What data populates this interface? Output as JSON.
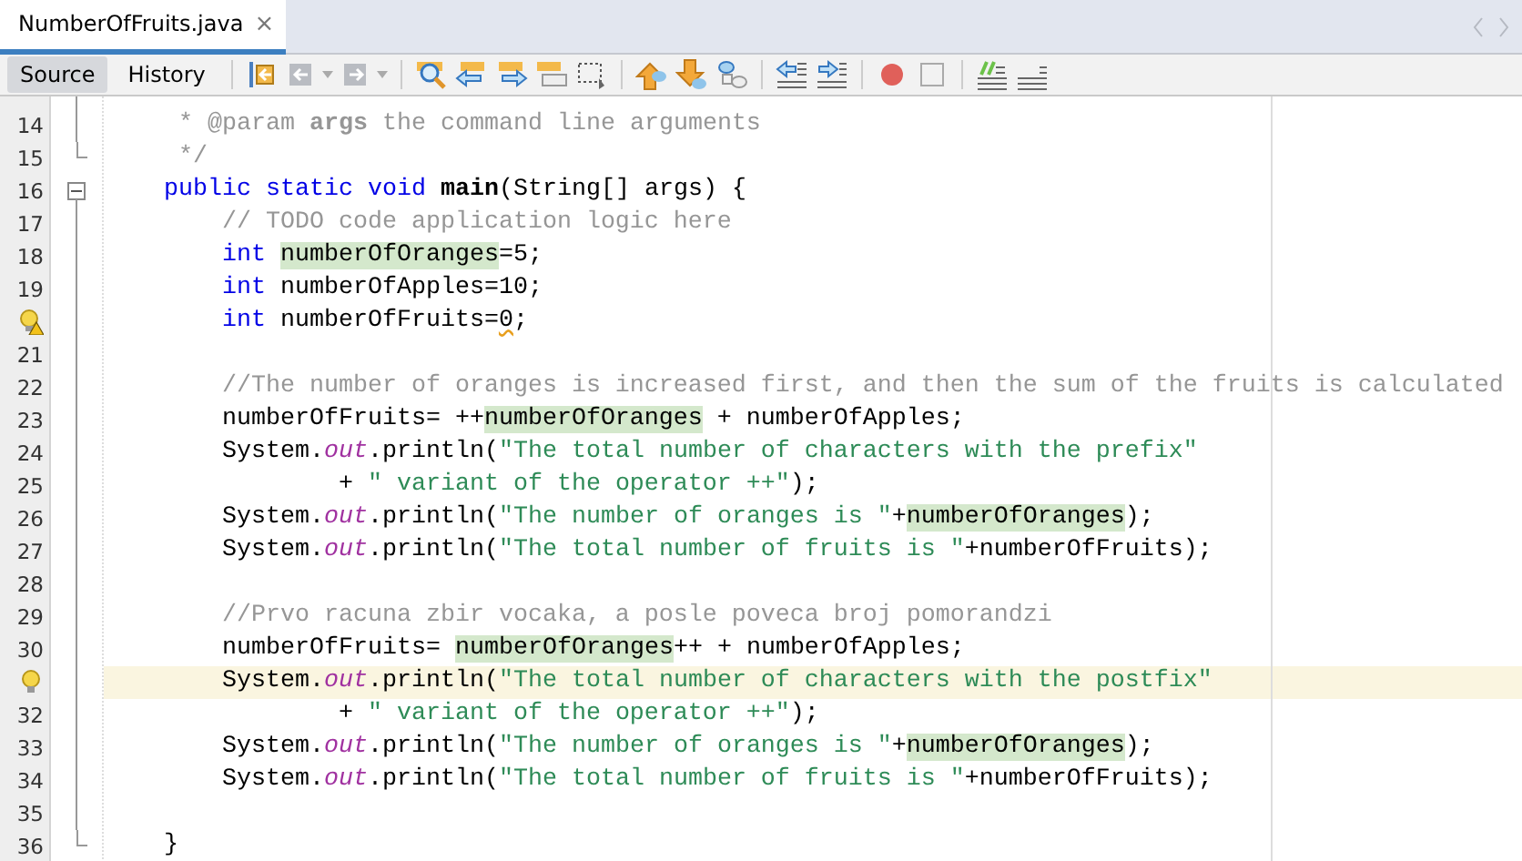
{
  "file_tab": {
    "title": "NumberOfFruits.java",
    "close": "×"
  },
  "view_tabs": [
    {
      "label": "Source",
      "selected": true
    },
    {
      "label": "History",
      "selected": false
    }
  ],
  "recording": {
    "on": false
  },
  "lines": [
    {
      "number": "14",
      "kind": "plain",
      "fold_start": false,
      "fold_end": false,
      "current": false,
      "tokens": [
        {
          "kind": "comment",
          "text": "     * @param "
        },
        {
          "kind": "commentbold",
          "text": "args"
        },
        {
          "kind": "comment",
          "text": " the command line arguments"
        }
      ]
    },
    {
      "number": "15",
      "kind": "plain",
      "fold_start": false,
      "fold_end": true,
      "current": false,
      "tokens": [
        {
          "kind": "comment",
          "text": "     */"
        }
      ]
    },
    {
      "number": "16",
      "kind": "plain",
      "fold_start": true,
      "fold_end": false,
      "current": false,
      "tokens": [
        {
          "kind": "kw",
          "text": "    public static void"
        },
        {
          "kind": "bold",
          "text": " main"
        },
        {
          "kind": "plain",
          "text": "(String[] args) {"
        }
      ]
    },
    {
      "number": "17",
      "kind": "plain",
      "fold_start": false,
      "fold_end": false,
      "current": false,
      "tokens": [
        {
          "kind": "comment",
          "text": "        // TODO code application logic here"
        }
      ]
    },
    {
      "number": "18",
      "kind": "plain",
      "fold_start": false,
      "fold_end": false,
      "current": false,
      "tokens": [
        {
          "kind": "kw",
          "text": "        int "
        },
        {
          "kind": "mark",
          "text": "numberOfOranges"
        },
        {
          "kind": "plain",
          "text": "=5;"
        }
      ]
    },
    {
      "number": "19",
      "kind": "plain",
      "fold_start": false,
      "fold_end": false,
      "current": false,
      "tokens": [
        {
          "kind": "kw",
          "text": "        int"
        },
        {
          "kind": "plain",
          "text": " numberOfApples=10;"
        }
      ]
    },
    {
      "kind": "warning",
      "fold_start": false,
      "fold_end": false,
      "current": false,
      "tokens": [
        {
          "kind": "kw",
          "text": "        int"
        },
        {
          "kind": "plain",
          "text": " numberOfFruits="
        },
        {
          "kind": "warn",
          "text": "0"
        },
        {
          "kind": "plain",
          "text": ";"
        }
      ]
    },
    {
      "number": "21",
      "kind": "plain",
      "fold_start": false,
      "fold_end": false,
      "current": false
    },
    {
      "number": "22",
      "kind": "plain",
      "fold_start": false,
      "fold_end": false,
      "current": false,
      "tokens": [
        {
          "kind": "comment",
          "text": "        //The number of oranges is increased first, and then the sum of the fruits is calculated"
        }
      ]
    },
    {
      "number": "23",
      "kind": "plain",
      "fold_start": false,
      "fold_end": false,
      "current": false,
      "tokens": [
        {
          "kind": "plain",
          "text": "        numberOfFruits= ++"
        },
        {
          "kind": "mark",
          "text": "numberOfOranges"
        },
        {
          "kind": "plain",
          "text": " + numberOfApples;"
        }
      ]
    },
    {
      "number": "24",
      "kind": "plain",
      "fold_start": false,
      "fold_end": false,
      "current": false,
      "tokens": [
        {
          "kind": "plain",
          "text": "        System."
        },
        {
          "kind": "field",
          "text": "out"
        },
        {
          "kind": "plain",
          "text": ".println("
        },
        {
          "kind": "string",
          "text": "\"The total number of characters with the prefix\""
        }
      ]
    },
    {
      "number": "25",
      "kind": "plain",
      "fold_start": false,
      "fold_end": false,
      "current": false,
      "tokens": [
        {
          "kind": "plain",
          "text": "                + "
        },
        {
          "kind": "string",
          "text": "\" variant of the operator ++\""
        },
        {
          "kind": "plain",
          "text": ");"
        }
      ]
    },
    {
      "number": "26",
      "kind": "plain",
      "fold_start": false,
      "fold_end": false,
      "current": false,
      "tokens": [
        {
          "kind": "plain",
          "text": "        System."
        },
        {
          "kind": "field",
          "text": "out"
        },
        {
          "kind": "plain",
          "text": ".println("
        },
        {
          "kind": "string",
          "text": "\"The number of oranges is \""
        },
        {
          "kind": "plain",
          "text": "+"
        },
        {
          "kind": "mark",
          "text": "numberOfOranges"
        },
        {
          "kind": "plain",
          "text": ");"
        }
      ]
    },
    {
      "number": "27",
      "kind": "plain",
      "fold_start": false,
      "fold_end": false,
      "current": false,
      "tokens": [
        {
          "kind": "plain",
          "text": "        System."
        },
        {
          "kind": "field",
          "text": "out"
        },
        {
          "kind": "plain",
          "text": ".println("
        },
        {
          "kind": "string",
          "text": "\"The total number of fruits is \""
        },
        {
          "kind": "plain",
          "text": "+numberOfFruits);"
        }
      ]
    },
    {
      "number": "28",
      "kind": "plain",
      "fold_start": false,
      "fold_end": false,
      "current": false
    },
    {
      "number": "29",
      "kind": "plain",
      "fold_start": false,
      "fold_end": false,
      "current": false,
      "tokens": [
        {
          "kind": "comment",
          "text": "        //Prvo racuna zbir vocaka, a posle poveca broj pomorandzi"
        }
      ]
    },
    {
      "number": "30",
      "kind": "plain",
      "fold_start": false,
      "fold_end": false,
      "current": false,
      "tokens": [
        {
          "kind": "plain",
          "text": "        numberOfFruits= "
        },
        {
          "kind": "mark",
          "text": "numberOfOranges"
        },
        {
          "kind": "plain",
          "text": "++ + numberOfApples;"
        }
      ]
    },
    {
      "kind": "hint",
      "fold_start": false,
      "fold_end": false,
      "current": true,
      "tokens": [
        {
          "kind": "plain",
          "text": "        System."
        },
        {
          "kind": "field",
          "text": "out"
        },
        {
          "kind": "plain",
          "text": ".println("
        },
        {
          "kind": "string",
          "text": "\"The total number of characters with the postfix\""
        }
      ]
    },
    {
      "number": "32",
      "kind": "plain",
      "fold_start": false,
      "fold_end": false,
      "current": false,
      "tokens": [
        {
          "kind": "plain",
          "text": "                + "
        },
        {
          "kind": "string",
          "text": "\" variant of the operator ++\""
        },
        {
          "kind": "plain",
          "text": ");"
        }
      ]
    },
    {
      "number": "33",
      "kind": "plain",
      "fold_start": false,
      "fold_end": false,
      "current": false,
      "tokens": [
        {
          "kind": "plain",
          "text": "        System."
        },
        {
          "kind": "field",
          "text": "out"
        },
        {
          "kind": "plain",
          "text": ".println("
        },
        {
          "kind": "string",
          "text": "\"The number of oranges is \""
        },
        {
          "kind": "plain",
          "text": "+"
        },
        {
          "kind": "mark",
          "text": "numberOfOranges"
        },
        {
          "kind": "plain",
          "text": ");"
        }
      ]
    },
    {
      "number": "34",
      "kind": "plain",
      "fold_start": false,
      "fold_end": false,
      "current": false,
      "tokens": [
        {
          "kind": "plain",
          "text": "        System."
        },
        {
          "kind": "field",
          "text": "out"
        },
        {
          "kind": "plain",
          "text": ".println("
        },
        {
          "kind": "string",
          "text": "\"The total number of fruits is \""
        },
        {
          "kind": "plain",
          "text": "+numberOfFruits);"
        }
      ]
    },
    {
      "number": "35",
      "kind": "plain",
      "fold_start": false,
      "fold_end": false,
      "current": false
    },
    {
      "number": "36",
      "kind": "plain",
      "fold_start": false,
      "fold_end": true,
      "current": false,
      "tokens": [
        {
          "kind": "plain",
          "text": "    }"
        }
      ]
    }
  ]
}
